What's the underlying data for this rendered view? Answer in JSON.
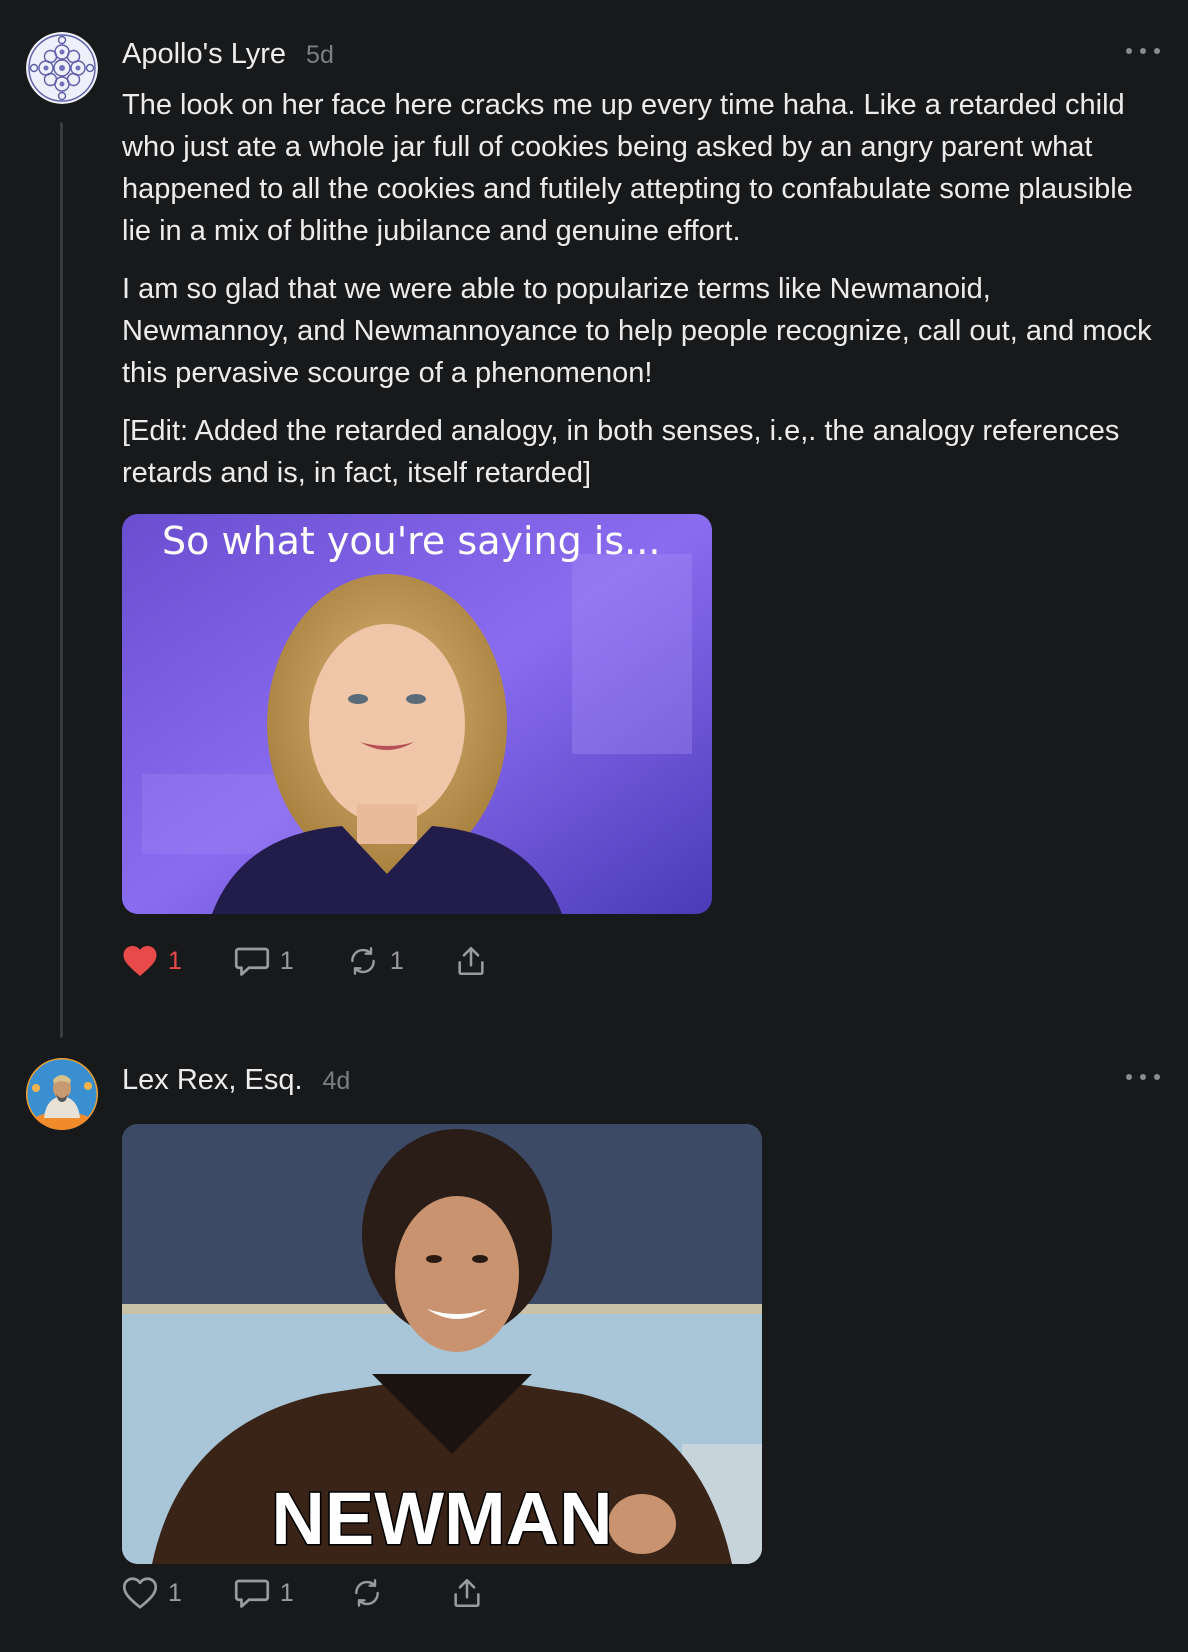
{
  "comments": [
    {
      "author": "Apollo's Lyre",
      "time": "5d",
      "avatar_icon": "fractal-circle-avatar",
      "paragraphs": [
        "The look on her face here cracks me up every time haha. Like a retarded child who just ate a whole jar full of cookies being asked by an angry parent what happened to all the cookies and futilely attepting to confabulate some plausible lie in a mix of blithe jubilance and genuine effort.",
        "I am so glad that we were able to popularize terms like Newmanoid, Newmannoy, and Newmannoyance to help people recognize, call out, and mock this pervasive scourge of a phenomenon!",
        "[Edit: Added the retarded analogy, in both senses, i.e,. the analogy references retards and is, in fact, itself retarded]"
      ],
      "image_caption": "So what you're saying is...",
      "likes": "1",
      "replies": "1",
      "restacks": "1",
      "liked": true
    },
    {
      "author": "Lex Rex, Esq.",
      "time": "4d",
      "avatar_icon": "statue-bust-avatar",
      "image_caption": "NEWMAN",
      "likes": "1",
      "replies": "1",
      "restacks": "",
      "liked": false
    }
  ],
  "colors": {
    "background": "#18191b",
    "like_red": "#e84a4a",
    "muted": "#9a9b9f"
  }
}
